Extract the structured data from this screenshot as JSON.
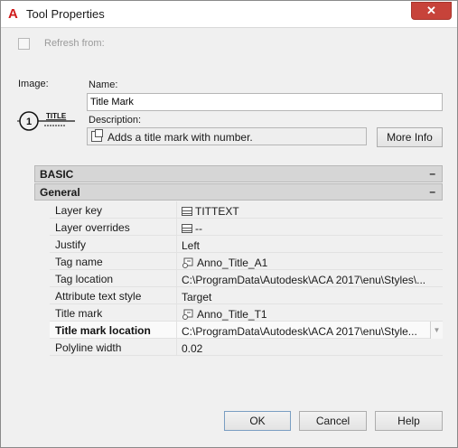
{
  "window": {
    "title": "Tool Properties",
    "close_glyph": "✕"
  },
  "refresh": {
    "label": "Refresh from:",
    "checked": false
  },
  "image": {
    "label": "Image:",
    "preview_number": "1",
    "preview_title": "TITLE"
  },
  "name": {
    "label": "Name:",
    "value": "Title Mark"
  },
  "description": {
    "label": "Description:",
    "value": "Adds a title mark with number.",
    "more_info_label": "More Info"
  },
  "groups": {
    "basic": {
      "label": "BASIC",
      "toggle": "–"
    },
    "general": {
      "label": "General",
      "toggle": "–"
    }
  },
  "properties": [
    {
      "key": "Layer key",
      "value": "TITTEXT",
      "icon": "table-icon"
    },
    {
      "key": "Layer overrides",
      "value": "--",
      "icon": "table-icon"
    },
    {
      "key": "Justify",
      "value": "Left",
      "icon": ""
    },
    {
      "key": "Tag name",
      "value": "Anno_Title_A1",
      "icon": "tag-icon"
    },
    {
      "key": "Tag location",
      "value": "C:\\ProgramData\\Autodesk\\ACA  2017\\enu\\Styles\\...",
      "icon": ""
    },
    {
      "key": "Attribute text style",
      "value": "Target",
      "icon": ""
    },
    {
      "key": "Title mark",
      "value": "Anno_Title_T1",
      "icon": "tag-icon"
    },
    {
      "key": "Title mark location",
      "value": "C:\\ProgramData\\Autodesk\\ACA  2017\\enu\\Style...",
      "icon": ""
    },
    {
      "key": "Polyline width",
      "value": "0.02",
      "icon": ""
    }
  ],
  "buttons": {
    "ok": "OK",
    "cancel": "Cancel",
    "help": "Help"
  },
  "colors": {
    "close_button": "#c7433a",
    "app_icon": "#d01b1b",
    "group_header": "#d6d6d6"
  }
}
